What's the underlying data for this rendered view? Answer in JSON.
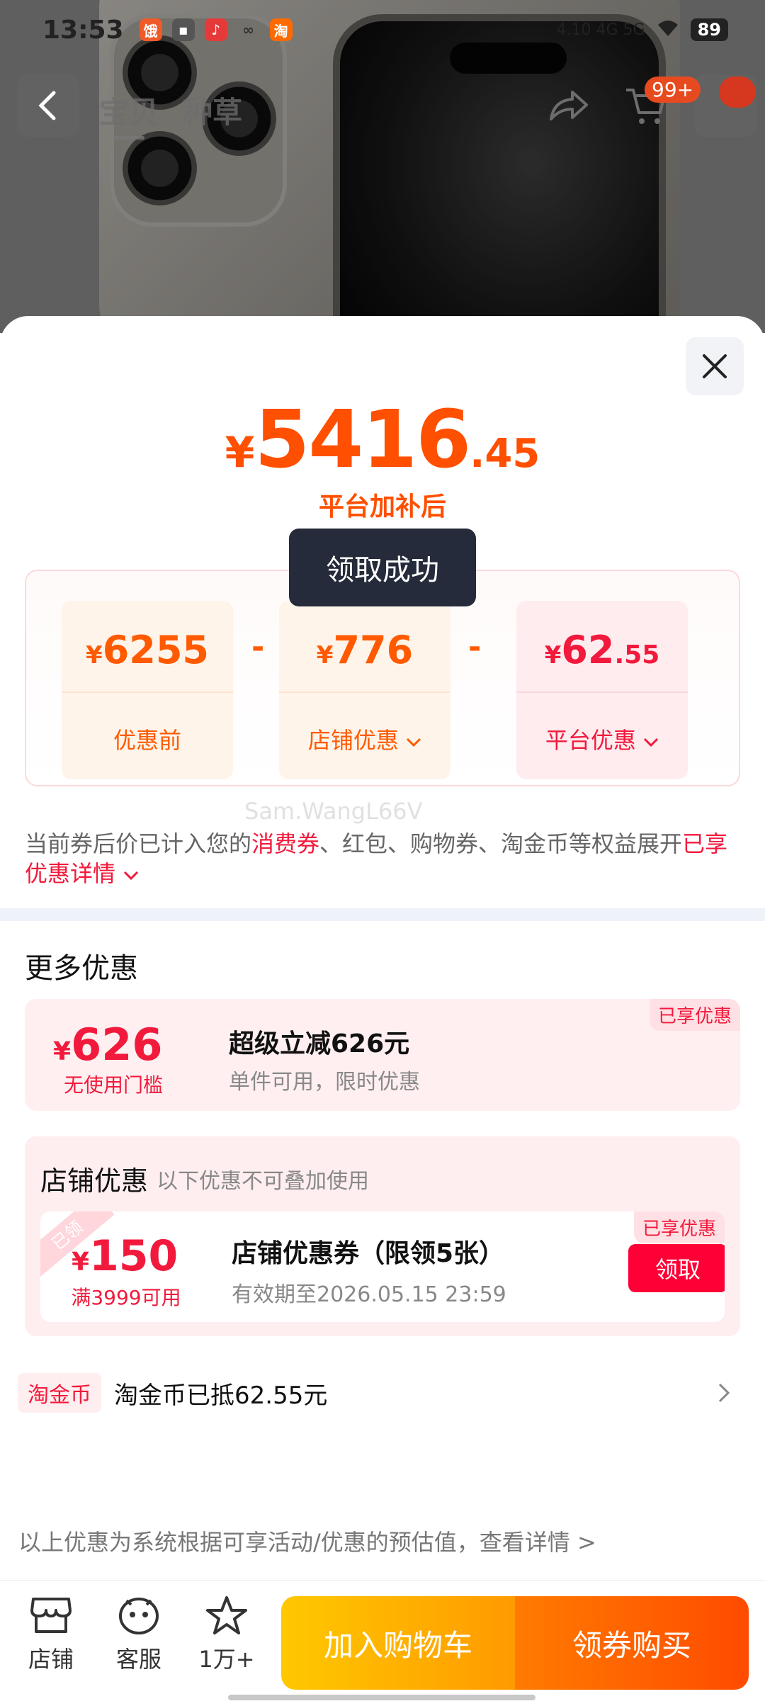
{
  "status_bar": {
    "time": "13:53",
    "network_info": "4.10 4G 5G",
    "battery": "89"
  },
  "nav": {
    "tabs": [
      "宝贝",
      "种草"
    ],
    "cart_badge": "99+"
  },
  "sheet": {
    "final_price": {
      "currency": "¥",
      "integer": "5416",
      "decimal": ".45",
      "caption": "平台加补后"
    },
    "breakdown": [
      {
        "currency": "¥",
        "integer": "6255",
        "decimal": "",
        "label": "优惠前",
        "has_dropdown": false
      },
      {
        "currency": "¥",
        "integer": "776",
        "decimal": "",
        "label": "店铺优惠",
        "has_dropdown": true
      },
      {
        "currency": "¥",
        "integer": "62",
        "decimal": ".55",
        "label": "平台优惠",
        "has_dropdown": true
      }
    ],
    "operator": "-",
    "watermark": "Sam.WangL66V",
    "explain": {
      "part1": "当前券后价已计入您的",
      "highlight1": "消费券",
      "part2": "、红包、购物券、淘金币等权益展开",
      "link": "已享优惠详情"
    },
    "toast": "领取成功",
    "more_title": "更多优惠",
    "super_promo": {
      "currency": "¥",
      "amount": "626",
      "condition": "无使用门槛",
      "title": "超级立减626元",
      "subtitle": "单件可用，限时优惠",
      "tag": "已享优惠"
    },
    "shop_promo": {
      "heading": "店铺优惠",
      "note": "以下优惠不可叠加使用",
      "ribbon": "已领",
      "currency": "¥",
      "amount": "150",
      "condition": "满3999可用",
      "title": "店铺优惠券（限领5张）",
      "validity": "有效期至2026.05.15 23:59",
      "tag": "已享优惠",
      "claim_label": "领取"
    },
    "coin": {
      "tag": "淘金币",
      "text": "淘金币已抵62.55元"
    },
    "footnote": "以上优惠为系统根据可享活动/优惠的预估值，查看详情 >"
  },
  "bottom_bar": {
    "shop_label": "店铺",
    "service_label": "客服",
    "fav_label": "1万+",
    "add_cart_label": "加入购物车",
    "buy_label": "领券购买"
  },
  "colors": {
    "price_orange": "#ff4f00",
    "promo_red": "#f21a3c",
    "toast_bg": "#252b3a"
  }
}
